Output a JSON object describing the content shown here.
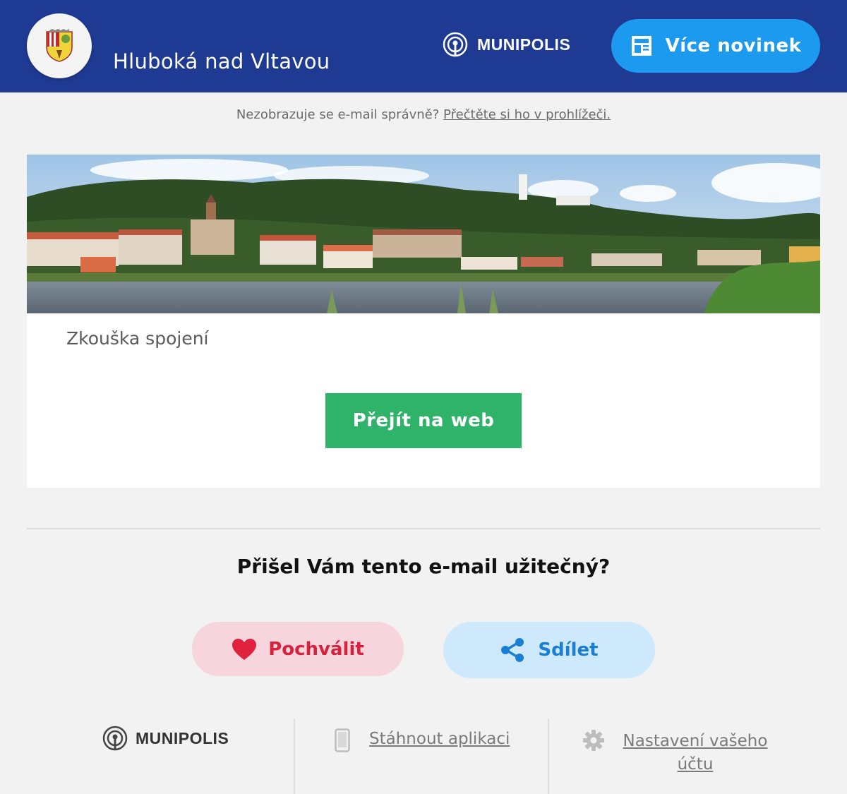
{
  "header": {
    "town_name": "Hluboká nad Vltavou",
    "brand": "MUNIPOLIS",
    "more_news_label": "Více novinek"
  },
  "browser_note": {
    "text": "Nezobrazuje se e-mail správně?",
    "link": "Přečtěte si ho v prohlížeči."
  },
  "article": {
    "title": "Zkouška spojení",
    "cta_label": "Přejít na web"
  },
  "feedback": {
    "question": "Přišel Vám tento e-mail užitečný?",
    "praise_label": "Pochválit",
    "share_label": "Sdílet"
  },
  "footer": {
    "brand": "MUNIPOLIS",
    "download_app": "Stáhnout aplikaci",
    "settings_line1": "Nastavení vašeho",
    "settings_line2": "účtu"
  },
  "colors": {
    "header_bg": "#1f3a93",
    "more_news_button": "#1c9af0",
    "cta_button": "#2fb36a",
    "praise_bg": "#f6d6dc",
    "praise_text": "#d8223d",
    "share_bg": "#cde9fb",
    "share_text": "#1a7fd4"
  },
  "icons": {
    "crest": "town-crest-icon",
    "broadcast": "broadcast-icon",
    "newspaper": "newspaper-icon",
    "heart": "heart-icon",
    "share": "share-icon",
    "phone": "phone-icon",
    "gear": "gear-icon"
  }
}
